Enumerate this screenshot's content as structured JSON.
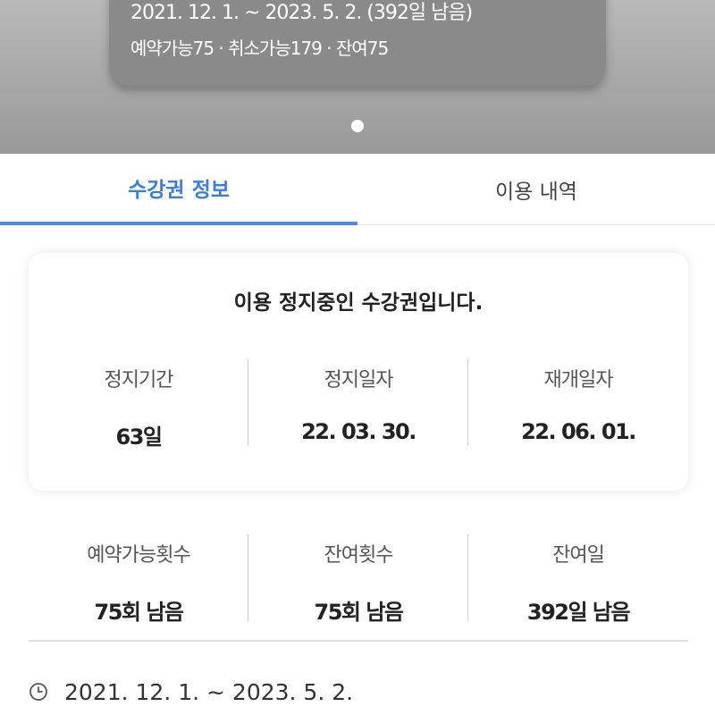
{
  "membership_card": {
    "period": "2021. 12. 1. ~ 2023. 5. 2. (392일 남음)",
    "counts": "예약가능75 · 취소가능179 · 잔여75"
  },
  "tabs": [
    {
      "label": "수강권 정보",
      "active": true
    },
    {
      "label": "이용 내역",
      "active": false
    }
  ],
  "pause_panel": {
    "title": "이용 정지중인 수강권입니다.",
    "items": [
      {
        "label": "정지기간",
        "value": "63일"
      },
      {
        "label": "정지일자",
        "value": "22. 03. 30."
      },
      {
        "label": "재개일자",
        "value": "22. 06. 01."
      }
    ]
  },
  "stats": [
    {
      "label": "예약가능횟수",
      "value": "75회 남음"
    },
    {
      "label": "잔여횟수",
      "value": "75회 남음"
    },
    {
      "label": "잔여일",
      "value": "392일 남음"
    }
  ],
  "usage_period": {
    "icon": "clock-icon",
    "text": "2021. 12. 1. ~ 2023. 5. 2."
  },
  "colors": {
    "accent": "#3b7ed8",
    "hero_bg": "#a8a8a8",
    "card_bg": "#8a8a8a"
  }
}
